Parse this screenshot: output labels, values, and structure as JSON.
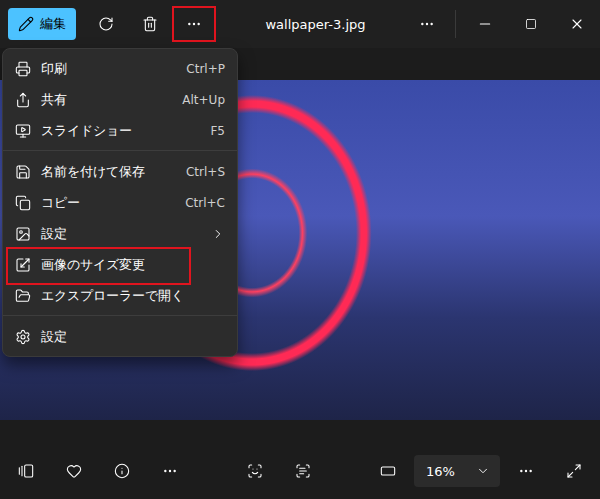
{
  "window": {
    "title": "wallpaper-3.jpg"
  },
  "toolbar": {
    "edit_label": "編集",
    "more_annotated": true
  },
  "menu": {
    "items": [
      {
        "kind": "item",
        "label": "印刷",
        "shortcut": "Ctrl+P",
        "annotated": false
      },
      {
        "kind": "item",
        "label": "共有",
        "shortcut": "Alt+Up",
        "annotated": false
      },
      {
        "kind": "item",
        "label": "スライドショー",
        "shortcut": "F5",
        "annotated": false
      },
      {
        "kind": "separator"
      },
      {
        "kind": "item",
        "label": "名前を付けて保存",
        "shortcut": "Ctrl+S",
        "annotated": false
      },
      {
        "kind": "item",
        "label": "コピー",
        "shortcut": "Ctrl+C",
        "annotated": false
      },
      {
        "kind": "submenu",
        "label": "設定",
        "annotated": false
      },
      {
        "kind": "item",
        "label": "画像のサイズ変更",
        "shortcut": "",
        "annotated": true
      },
      {
        "kind": "item",
        "label": "エクスプローラーで開く",
        "shortcut": "",
        "annotated": false
      },
      {
        "kind": "separator"
      },
      {
        "kind": "item",
        "label": "設定",
        "shortcut": "",
        "annotated": false
      }
    ]
  },
  "zoom": {
    "value": "16%"
  }
}
